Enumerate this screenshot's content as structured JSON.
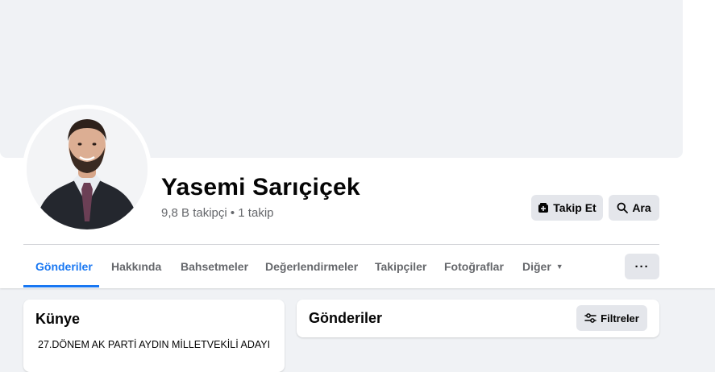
{
  "profile": {
    "name": "Yasemi Sarıçiçek",
    "stats": "9,8 B takipçi • 1 takip"
  },
  "actions": {
    "follow_label": "Takip Et",
    "search_label": "Ara",
    "more_label": "···"
  },
  "tabs": [
    {
      "label": "Gönderiler",
      "active": true
    },
    {
      "label": "Hakkında"
    },
    {
      "label": "Bahsetmeler"
    },
    {
      "label": "Değerlendirmeler"
    },
    {
      "label": "Takipçiler"
    },
    {
      "label": "Fotoğraflar"
    },
    {
      "label": "Diğer",
      "dropdown": true
    }
  ],
  "intro": {
    "title": "Künye",
    "bio": "27.DÖNEM AK PARTİ AYDIN MİLLETVEKİLİ ADAYI"
  },
  "posts": {
    "title": "Gönderiler",
    "filter_label": "Filtreler"
  },
  "icons": {
    "follow": "user-plus-icon",
    "search": "search-icon",
    "more": "ellipsis-icon",
    "filter": "sliders-icon",
    "dropdown": "caret-down-icon"
  },
  "colors": {
    "accent": "#1877f2",
    "button_bg": "#e4e6eb",
    "page_bg": "#f0f2f5",
    "secondary_text": "#65676b"
  }
}
